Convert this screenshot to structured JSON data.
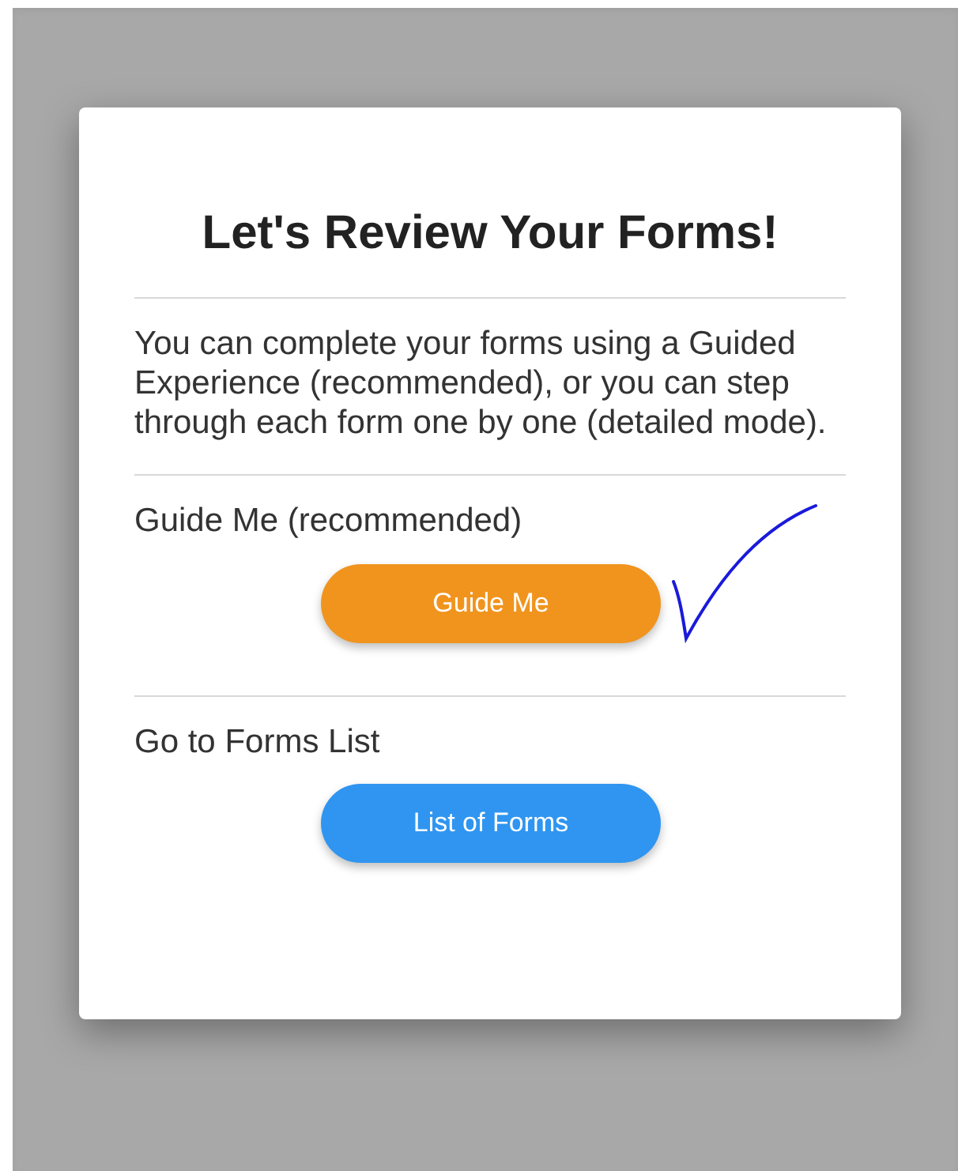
{
  "dialog": {
    "title": "Let's Review Your Forms!",
    "intro": "You can complete your forms using a Guided Experience (recommended), or you can step through each form one by one (detailed mode).",
    "options": [
      {
        "label": "Guide Me (recommended)",
        "button": "Guide Me",
        "color": "#f0941e",
        "ticked": true
      },
      {
        "label": "Go to Forms List",
        "button": "List of Forms",
        "color": "#2f95f0",
        "ticked": false
      }
    ]
  }
}
